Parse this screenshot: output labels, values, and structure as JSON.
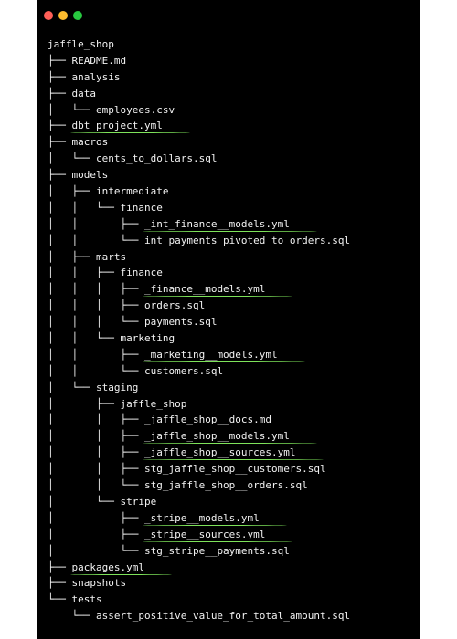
{
  "window": {
    "buttons": [
      {
        "name": "close",
        "color": "#ff5f57"
      },
      {
        "name": "minimize",
        "color": "#febc2e"
      },
      {
        "name": "maximize",
        "color": "#28c840"
      }
    ]
  },
  "highlight_color": "#7ee35a",
  "tree": [
    {
      "prefix": "",
      "name": "jaffle_shop",
      "highlighted": false
    },
    {
      "prefix": "├── ",
      "name": "README.md",
      "highlighted": false
    },
    {
      "prefix": "├── ",
      "name": "analysis",
      "highlighted": false
    },
    {
      "prefix": "├── ",
      "name": "data",
      "highlighted": false
    },
    {
      "prefix": "│   └── ",
      "name": "employees.csv",
      "highlighted": false
    },
    {
      "prefix": "├── ",
      "name": "dbt_project.yml",
      "highlighted": true
    },
    {
      "prefix": "├── ",
      "name": "macros",
      "highlighted": false
    },
    {
      "prefix": "│   └── ",
      "name": "cents_to_dollars.sql",
      "highlighted": false
    },
    {
      "prefix": "├── ",
      "name": "models",
      "highlighted": false
    },
    {
      "prefix": "│   ├── ",
      "name": "intermediate",
      "highlighted": false
    },
    {
      "prefix": "│   │   └── ",
      "name": "finance",
      "highlighted": false
    },
    {
      "prefix": "│   │       ├── ",
      "name": "_int_finance__models.yml",
      "highlighted": true
    },
    {
      "prefix": "│   │       └── ",
      "name": "int_payments_pivoted_to_orders.sql",
      "highlighted": false
    },
    {
      "prefix": "│   ├── ",
      "name": "marts",
      "highlighted": false
    },
    {
      "prefix": "│   │   ├── ",
      "name": "finance",
      "highlighted": false
    },
    {
      "prefix": "│   │   │   ├── ",
      "name": "_finance__models.yml",
      "highlighted": true
    },
    {
      "prefix": "│   │   │   ├── ",
      "name": "orders.sql",
      "highlighted": false
    },
    {
      "prefix": "│   │   │   └── ",
      "name": "payments.sql",
      "highlighted": false
    },
    {
      "prefix": "│   │   └── ",
      "name": "marketing",
      "highlighted": false
    },
    {
      "prefix": "│   │       ├── ",
      "name": "_marketing__models.yml",
      "highlighted": true
    },
    {
      "prefix": "│   │       └── ",
      "name": "customers.sql",
      "highlighted": false
    },
    {
      "prefix": "│   └── ",
      "name": "staging",
      "highlighted": false
    },
    {
      "prefix": "│       ├── ",
      "name": "jaffle_shop",
      "highlighted": false
    },
    {
      "prefix": "│       │   ├── ",
      "name": "_jaffle_shop__docs.md",
      "highlighted": false
    },
    {
      "prefix": "│       │   ├── ",
      "name": "_jaffle_shop__models.yml",
      "highlighted": true
    },
    {
      "prefix": "│       │   ├── ",
      "name": "_jaffle_shop__sources.yml",
      "highlighted": true
    },
    {
      "prefix": "│       │   ├── ",
      "name": "stg_jaffle_shop__customers.sql",
      "highlighted": false
    },
    {
      "prefix": "│       │   └── ",
      "name": "stg_jaffle_shop__orders.sql",
      "highlighted": false
    },
    {
      "prefix": "│       └── ",
      "name": "stripe",
      "highlighted": false
    },
    {
      "prefix": "│           ├── ",
      "name": "_stripe__models.yml",
      "highlighted": true
    },
    {
      "prefix": "│           ├── ",
      "name": "_stripe__sources.yml",
      "highlighted": true
    },
    {
      "prefix": "│           └── ",
      "name": "stg_stripe__payments.sql",
      "highlighted": false
    },
    {
      "prefix": "├── ",
      "name": "packages.yml",
      "highlighted": true
    },
    {
      "prefix": "├── ",
      "name": "snapshots",
      "highlighted": false
    },
    {
      "prefix": "└── ",
      "name": "tests",
      "highlighted": false
    },
    {
      "prefix": "    └── ",
      "name": "assert_positive_value_for_total_amount.sql",
      "highlighted": false
    }
  ]
}
